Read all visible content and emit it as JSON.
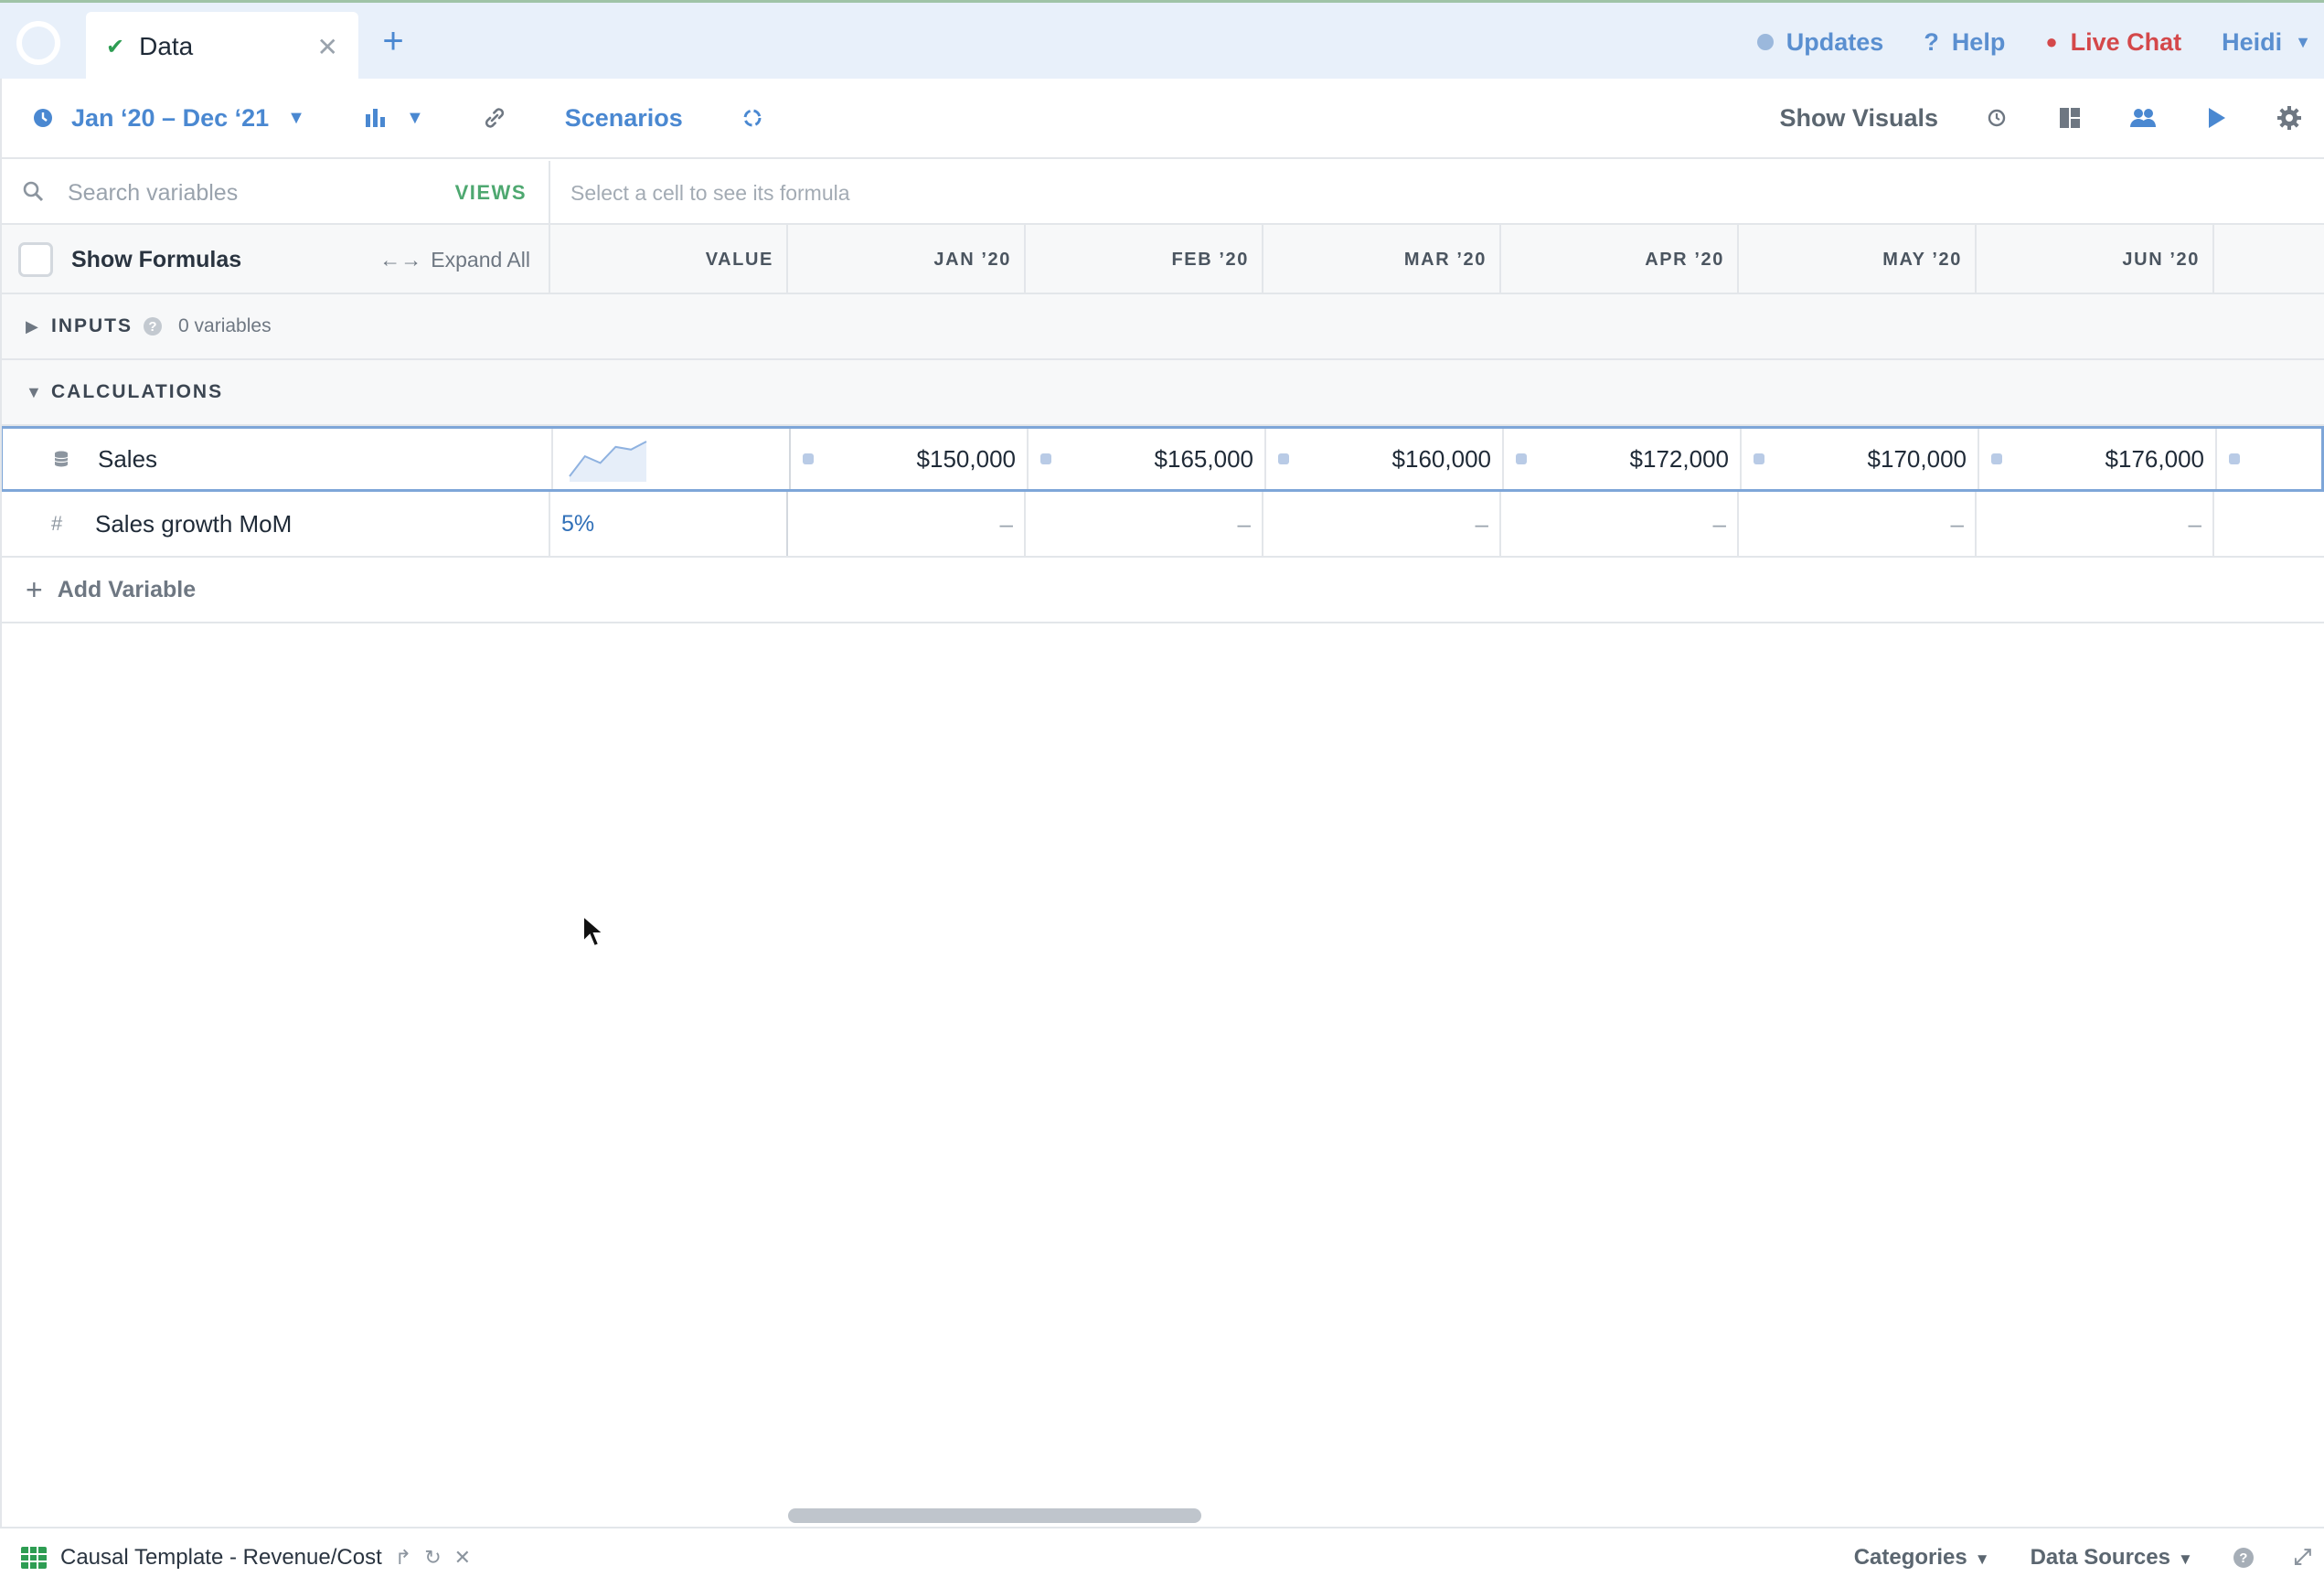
{
  "tab": {
    "title": "Data"
  },
  "top_nav": {
    "updates": "Updates",
    "help": "Help",
    "live_chat": "Live Chat",
    "user": "Heidi"
  },
  "toolbar": {
    "date_range": "Jan ‘20 – Dec ‘21",
    "scenarios": "Scenarios",
    "show_visuals": "Show Visuals"
  },
  "search": {
    "placeholder": "Search variables",
    "views": "VIEWS",
    "formula_hint": "Select a cell to see its formula"
  },
  "grid": {
    "show_formulas": "Show Formulas",
    "expand_all": "Expand All",
    "value_header": "VALUE",
    "columns": [
      "JAN ’20",
      "FEB ’20",
      "MAR ’20",
      "APR ’20",
      "MAY ’20",
      "JUN ’20"
    ]
  },
  "sections": {
    "inputs": {
      "label": "INPUTS",
      "count": "0 variables"
    },
    "calculations": {
      "label": "CALCULATIONS"
    }
  },
  "rows": [
    {
      "name": "Sales",
      "type_icon": "database-icon",
      "value": "",
      "sparkline": [
        150000,
        165000,
        160000,
        172000,
        170000,
        176000
      ],
      "cells": [
        "$150,000",
        "$165,000",
        "$160,000",
        "$172,000",
        "$170,000",
        "$176,000"
      ]
    },
    {
      "name": "Sales growth MoM",
      "type_icon": "hash-icon",
      "value": "5%",
      "cells": [
        "–",
        "–",
        "–",
        "–",
        "–",
        "–"
      ]
    }
  ],
  "add_variable": "Add Variable",
  "bottom": {
    "sheet_name": "Causal Template - Revenue/Cost",
    "categories": "Categories",
    "data_sources": "Data Sources"
  },
  "colors": {
    "accent": "#4a88d1",
    "live_chat": "#d4484a",
    "views": "#4ea870",
    "tab_bar_bg": "#e8f0fa"
  }
}
